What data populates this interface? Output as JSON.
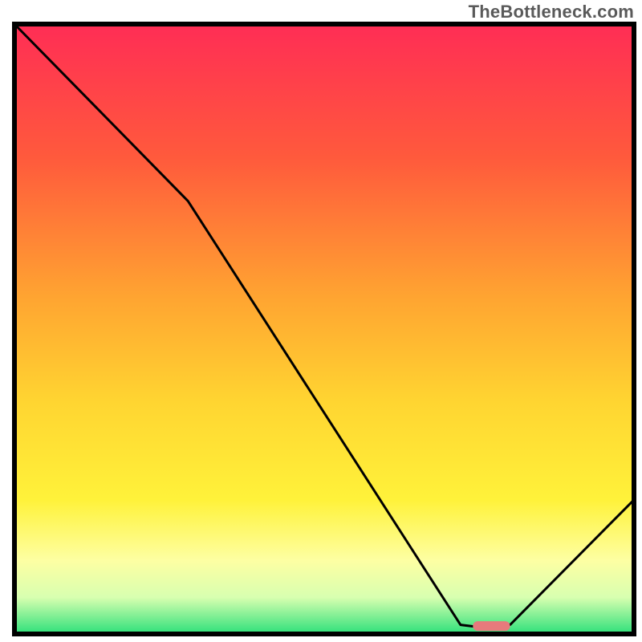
{
  "watermark": "TheBottleneck.com",
  "chart_data": {
    "type": "line",
    "title": "",
    "xlabel": "",
    "ylabel": "",
    "xlim": [
      0,
      100
    ],
    "ylim": [
      0,
      100
    ],
    "grid": false,
    "series": [
      {
        "name": "bottleneck-curve",
        "x": [
          0,
          28,
          72,
          76,
          78,
          80,
          100
        ],
        "y": [
          100,
          71,
          1.5,
          1.0,
          1.0,
          1.5,
          22
        ]
      }
    ],
    "marker": {
      "name": "optimal-region",
      "x_start": 74,
      "x_end": 80,
      "y": 1.3,
      "color": "#e77a7c"
    },
    "gradient_stops": [
      {
        "offset": 0.0,
        "color": "#ff2d55"
      },
      {
        "offset": 0.22,
        "color": "#ff5a3c"
      },
      {
        "offset": 0.45,
        "color": "#ffa531"
      },
      {
        "offset": 0.62,
        "color": "#ffd531"
      },
      {
        "offset": 0.78,
        "color": "#fff23a"
      },
      {
        "offset": 0.88,
        "color": "#fdffa3"
      },
      {
        "offset": 0.94,
        "color": "#d8ffb0"
      },
      {
        "offset": 1.0,
        "color": "#2de07a"
      }
    ],
    "frame_color": "#000000",
    "curve_color": "#000000",
    "curve_width": 3
  }
}
